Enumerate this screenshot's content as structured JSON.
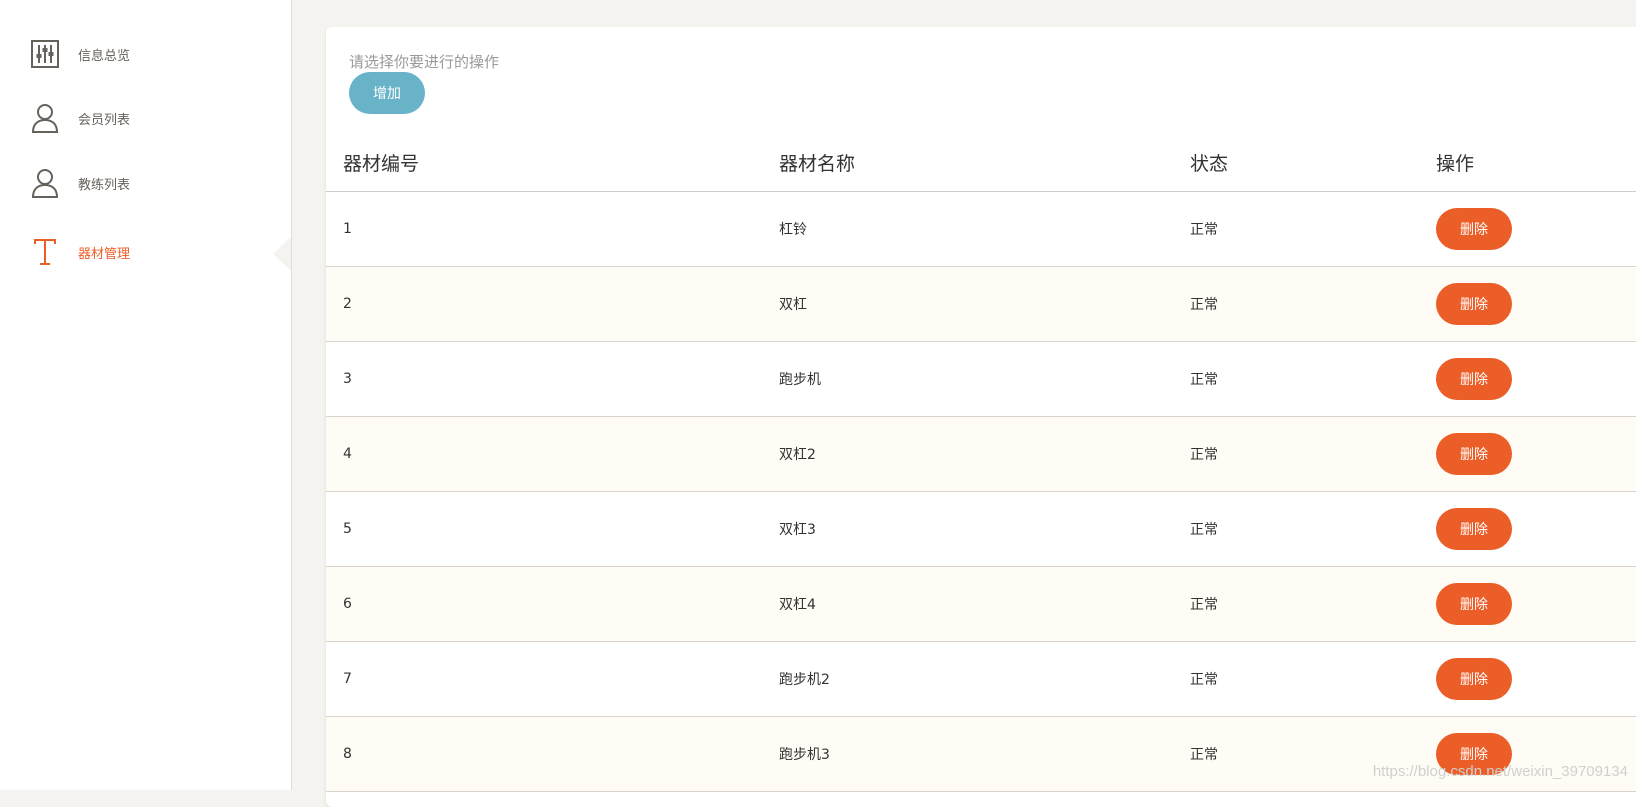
{
  "sidebar": {
    "items": [
      {
        "label": "信息总览",
        "icon": "sliders-icon",
        "active": false
      },
      {
        "label": "会员列表",
        "icon": "user-icon",
        "active": false
      },
      {
        "label": "教练列表",
        "icon": "user-icon",
        "active": false
      },
      {
        "label": "器材管理",
        "icon": "text-t-icon",
        "active": true
      }
    ]
  },
  "colors": {
    "accent": "#eb5e28",
    "info": "#68b3c8",
    "background": "#f4f3ef"
  },
  "main": {
    "prompt": "请选择你要进行的操作",
    "add_label": "增加",
    "table": {
      "headers": [
        "器材编号",
        "器材名称",
        "状态",
        "操作"
      ],
      "delete_label": "删除",
      "rows": [
        {
          "id": "1",
          "name": "杠铃",
          "status": "正常"
        },
        {
          "id": "2",
          "name": "双杠",
          "status": "正常"
        },
        {
          "id": "3",
          "name": "跑步机",
          "status": "正常"
        },
        {
          "id": "4",
          "name": "双杠2",
          "status": "正常"
        },
        {
          "id": "5",
          "name": "双杠3",
          "status": "正常"
        },
        {
          "id": "6",
          "name": "双杠4",
          "status": "正常"
        },
        {
          "id": "7",
          "name": "跑步机2",
          "status": "正常"
        },
        {
          "id": "8",
          "name": "跑步机3",
          "status": "正常"
        }
      ]
    }
  },
  "watermark": "https://blog.csdn.net/weixin_39709134"
}
